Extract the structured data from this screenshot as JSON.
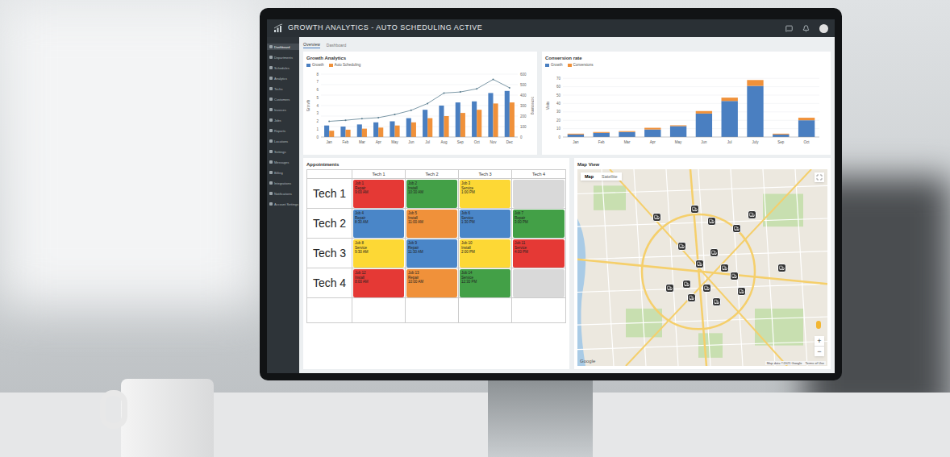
{
  "window": {
    "title": "GROWTH ANALYTICS - AUTO SCHEDULING ACTIVE"
  },
  "sidebar": {
    "items": [
      {
        "label": "Dashboard",
        "selected": true
      },
      {
        "label": "Departments",
        "selected": false
      },
      {
        "label": "Schedules",
        "selected": false
      },
      {
        "label": "Analytics",
        "selected": false
      },
      {
        "label": "Techs",
        "selected": false
      },
      {
        "label": "Customers",
        "selected": false
      },
      {
        "label": "Invoices",
        "selected": false
      },
      {
        "label": "Jobs",
        "selected": false
      },
      {
        "label": "Reports",
        "selected": false
      },
      {
        "label": "Locations",
        "selected": false
      },
      {
        "label": "Settings",
        "selected": false
      },
      {
        "label": "Messages",
        "selected": false
      },
      {
        "label": "Billing",
        "selected": false
      },
      {
        "label": "Integrations",
        "selected": false
      },
      {
        "label": "Notifications",
        "selected": false
      },
      {
        "label": "Account Settings",
        "selected": false
      }
    ]
  },
  "tabs": [
    {
      "label": "Overview",
      "selected": true
    },
    {
      "label": "Dashboard",
      "selected": false
    }
  ],
  "growth_chart": {
    "title": "Growth Analytics",
    "legend": [
      {
        "label": "Growth",
        "color": "#4a7fc1"
      },
      {
        "label": "Auto Scheduling",
        "color": "#f0913a"
      }
    ],
    "months": [
      "Jan",
      "Feb",
      "Mar",
      "Apr",
      "May",
      "Jun",
      "Jul",
      "Aug",
      "Sep",
      "Oct",
      "Nov",
      "Dec"
    ],
    "left_title": "Growth",
    "right_title": "Scheduling",
    "left_ticks": [
      "0",
      "1",
      "2",
      "3",
      "4",
      "5",
      "6",
      "7",
      "8"
    ],
    "right_ticks": [
      "0",
      "100",
      "200",
      "300",
      "400",
      "500",
      "600"
    ],
    "growth": [
      110,
      100,
      120,
      140,
      150,
      180,
      260,
      300,
      330,
      340,
      420,
      440
    ],
    "auto_scheduling": [
      60,
      70,
      80,
      90,
      110,
      140,
      180,
      200,
      230,
      260,
      320,
      330
    ],
    "trend": [
      150,
      160,
      175,
      185,
      215,
      255,
      320,
      420,
      430,
      460,
      550,
      470
    ]
  },
  "conversion_chart": {
    "title": "Conversion rate",
    "legend": [
      {
        "label": "Growth",
        "color": "#4a7fc1"
      },
      {
        "label": "Conversions",
        "color": "#f0913a"
      }
    ],
    "axis_title": "Visits",
    "months": [
      "Jan",
      "Feb",
      "Mar",
      "Apr",
      "May",
      "Jun",
      "Jul",
      "July",
      "Sep",
      "Oct"
    ],
    "ticks": [
      "0",
      "10",
      "20",
      "30",
      "40",
      "50",
      "60",
      "70"
    ],
    "growth": [
      3,
      5,
      6,
      9,
      13,
      28,
      43,
      61,
      3,
      20
    ],
    "conversions": [
      1,
      1,
      1,
      2,
      1,
      3,
      4,
      7,
      1,
      3
    ]
  },
  "appointments": {
    "title": "Appointments",
    "columns": [
      "Tech 1",
      "Tech 2",
      "Tech 3",
      "Tech 4"
    ],
    "rows": [
      {
        "label": "Tech 1",
        "cells": [
          {
            "lines": [
              "Job 1",
              "Repair",
              "9:00 AM"
            ],
            "color": "#e53935"
          },
          {
            "lines": [
              "Job 2",
              "Install",
              "10:30 AM"
            ],
            "color": "#43a047"
          },
          {
            "lines": [
              "Job 3",
              "Service",
              "1:00 PM"
            ],
            "color": "#fdd835"
          },
          {
            "lines": [],
            "color": "#d9d9d9"
          }
        ]
      },
      {
        "label": "Tech 2",
        "cells": [
          {
            "lines": [
              "Job 4",
              "Repair",
              "8:30 AM"
            ],
            "color": "#4a86c8"
          },
          {
            "lines": [
              "Job 5",
              "Install",
              "11:00 AM"
            ],
            "color": "#f0913a"
          },
          {
            "lines": [
              "Job 6",
              "Service",
              "1:30 PM"
            ],
            "color": "#4a86c8"
          },
          {
            "lines": [
              "Job 7",
              "Repair",
              "3:00 PM"
            ],
            "color": "#43a047"
          }
        ]
      },
      {
        "label": "Tech 3",
        "cells": [
          {
            "lines": [
              "Job 8",
              "Service",
              "9:30 AM"
            ],
            "color": "#fdd835"
          },
          {
            "lines": [
              "Job 9",
              "Repair",
              "11:30 AM"
            ],
            "color": "#4a86c8"
          },
          {
            "lines": [
              "Job 10",
              "Install",
              "2:00 PM"
            ],
            "color": "#fdd835"
          },
          {
            "lines": [
              "Job 11",
              "Service",
              "4:00 PM"
            ],
            "color": "#e53935"
          }
        ]
      },
      {
        "label": "Tech 4",
        "cells": [
          {
            "lines": [
              "Job 12",
              "Install",
              "8:00 AM"
            ],
            "color": "#e53935"
          },
          {
            "lines": [
              "Job 13",
              "Repair",
              "10:00 AM"
            ],
            "color": "#f0913a"
          },
          {
            "lines": [
              "Job 14",
              "Service",
              "12:30 PM"
            ],
            "color": "#43a047"
          },
          {
            "lines": [],
            "color": "#d9d9d9"
          }
        ]
      },
      {
        "label": "",
        "cells": [
          {
            "lines": [],
            "color": "#ffffff"
          },
          {
            "lines": [],
            "color": "#ffffff"
          },
          {
            "lines": [],
            "color": "#ffffff"
          },
          {
            "lines": [],
            "color": "#ffffff"
          }
        ]
      }
    ]
  },
  "map": {
    "title": "Map View",
    "tabs": [
      {
        "label": "Map",
        "selected": true
      },
      {
        "label": "Satellite",
        "selected": false
      }
    ],
    "zoom_in": "+",
    "zoom_out": "−",
    "logo": "Google",
    "attribution": "Map data ©2021 Google",
    "terms": "Terms of Use"
  }
}
